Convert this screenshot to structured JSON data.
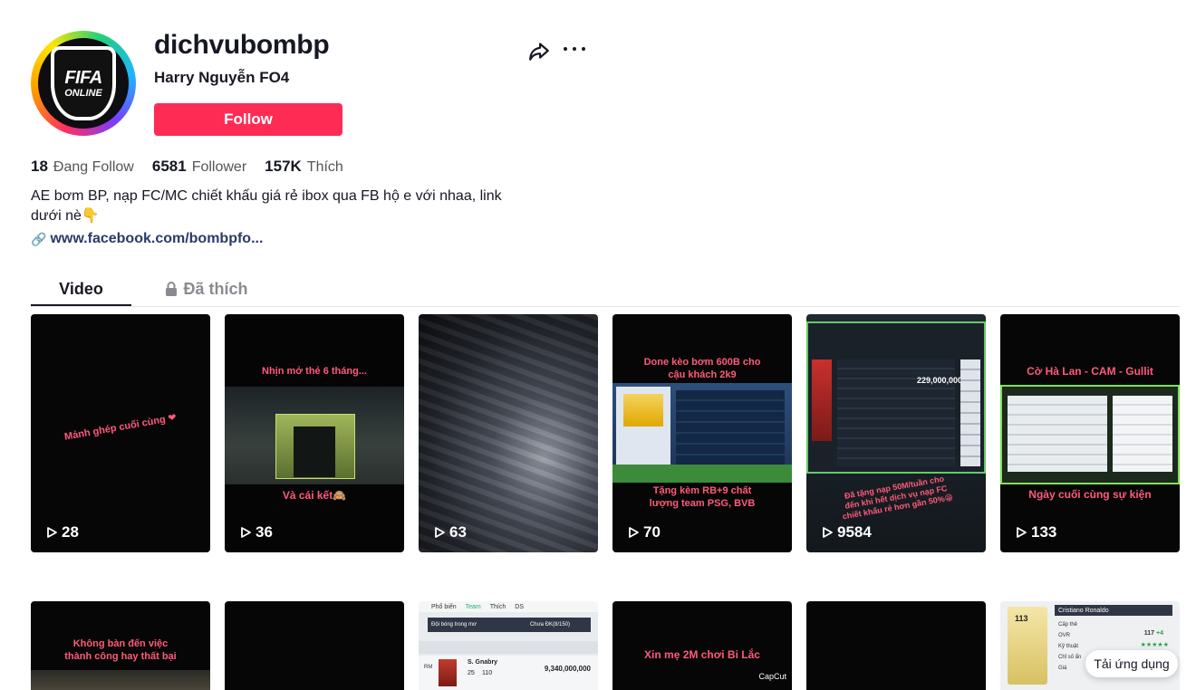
{
  "profile": {
    "username": "dichvubombp",
    "nickname": "Harry Nguyễn FO4",
    "avatar_text_1": "FIFA",
    "avatar_text_2": "ONLINE",
    "follow_label": "Follow",
    "stats": [
      {
        "value": "18",
        "label": "Đang Follow"
      },
      {
        "value": "6581",
        "label": "Follower"
      },
      {
        "value": "157K",
        "label": "Thích"
      }
    ],
    "bio_line1": "AE bơm BP, nạp FC/MC chiết khấu giá rẻ ibox qua FB hộ e với nhaa, link",
    "bio_line2": "dưới nè👇",
    "link_text": "www.facebook.com/bombpfo..."
  },
  "tabs": {
    "video": "Video",
    "liked": "Đã thích"
  },
  "videos": [
    {
      "views": "28",
      "caption": "Mảnh ghép cuối cùng ❤"
    },
    {
      "views": "36",
      "caption_top": "Nhịn mở thẻ 6 tháng...",
      "caption_bottom": "Và cái kết🙈"
    },
    {
      "views": "63"
    },
    {
      "views": "70",
      "caption_top": "Done kèo bơm 600B cho cậu khách 2k9",
      "caption_bottom": "Tặng kèm RB+9 chất lượng team PSG, BVB",
      "price_text": "229,000,000"
    },
    {
      "views": "9584",
      "caption_bottom": "Đã tặng nạp 50M/tuần cho đến khi hết dịch vụ nạp FC chiết khấu rẻ hơn gần 50%😁"
    },
    {
      "views": "133",
      "caption_top": "Cờ Hà Lan - CAM - Gullit",
      "caption_bottom": "Ngày cuối cùng sự kiện"
    }
  ],
  "videos_row2": [
    {
      "caption": "Không bàn đến việc thành công hay thất bại"
    },
    {},
    {
      "menu": [
        "Phổ biến",
        "Team",
        "Thích",
        "DS"
      ],
      "club_label": "Đội bóng trong mơ",
      "squad": "Chưa ĐK(8/150)",
      "player": "S. Gnabry",
      "player_ovr": "110",
      "price": "9,340,000,000",
      "position": "RM",
      "level": "25"
    },
    {
      "caption": "Xin mẹ 2M chơi Bi Lắc",
      "watermark": "CapCut"
    },
    {},
    {
      "player": "Cristiano Ronaldo",
      "ovr": "113",
      "ovr2": "117",
      "plus": "+4",
      "stars": "★★★★★",
      "row_labels": [
        "Cấp thẻ",
        "OVR",
        "Kỹ thuật",
        "Chỉ số ẩn",
        "Giá"
      ]
    }
  ],
  "open_app_label": "Tải ứng dụng",
  "colors": {
    "accent": "#fe2c55",
    "link": "#2b3a67"
  }
}
